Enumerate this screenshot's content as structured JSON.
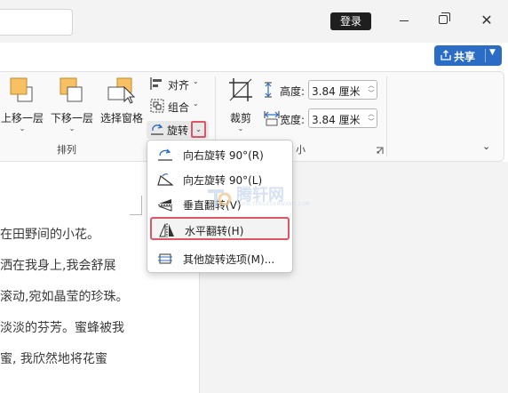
{
  "titlebar": {
    "login_label": "登录",
    "controls": [
      "minimize-icon",
      "restore-icon",
      "close-icon"
    ]
  },
  "share": {
    "label": "共享",
    "icon": "share-icon",
    "color": "#2b6cc4"
  },
  "ribbon": {
    "arrange_group": {
      "label": "排列",
      "buttons": [
        {
          "label": "上移一层",
          "icon": "bring-forward-icon"
        },
        {
          "label": "下移一层",
          "icon": "send-backward-icon"
        },
        {
          "label": "选择窗格",
          "icon": "selection-pane-icon"
        }
      ],
      "small_buttons": [
        {
          "label": "对齐",
          "icon": "align-icon"
        },
        {
          "label": "组合",
          "icon": "group-icon"
        },
        {
          "label": "旋转",
          "icon": "rotate-icon"
        }
      ]
    },
    "size_group": {
      "label": "小",
      "crop_label": "裁剪",
      "height_label": "高度:",
      "height_value": "3.84 厘米",
      "width_label": "宽度:",
      "width_value": "3.84 厘米"
    }
  },
  "rotate_menu": {
    "items": [
      {
        "label": "向右旋转 90°(R)",
        "icon": "rotate-right-icon"
      },
      {
        "label": "向左旋转 90°(L)",
        "icon": "rotate-left-icon"
      },
      {
        "label": "垂直翻转(V)",
        "icon": "flip-vertical-icon"
      },
      {
        "label": "水平翻转(H)",
        "icon": "flip-horizontal-icon"
      },
      {
        "label": "其他旋转选项(M)...",
        "icon": "more-rotation-icon"
      }
    ],
    "highlight_color": "#e05565"
  },
  "document": {
    "lines": [
      "在田野间的小花。",
      "洒在我身上,我会舒展",
      "滚动,宛如晶莹的珍珠。",
      "淡淡的芬芳。蜜蜂被我",
      "蜜, 我欣然地将花蜜"
    ]
  },
  "watermark": {
    "text": "腾轩网",
    "sub": "WWW.TENGXUANWANG.COM"
  }
}
